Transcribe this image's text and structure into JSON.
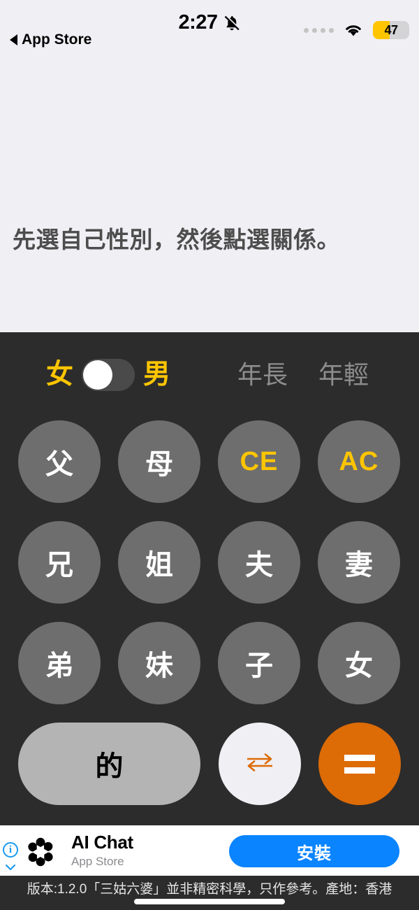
{
  "status_bar": {
    "time": "2:27",
    "back_label": "App Store",
    "bell_icon": "bell-slash-icon",
    "wifi_icon": "wifi-icon",
    "battery_percent": "47",
    "battery_level": 47,
    "battery_color": "#FFC500",
    "signal_dots": 4
  },
  "content": {
    "instruction": "先選自己性別，然後點選關係。",
    "background_color": "#f0eff4",
    "text_color": "#4d4d4d"
  },
  "controls": {
    "gender": {
      "left_label": "女",
      "right_label": "男",
      "selected": "女",
      "knob_position": "left",
      "accent_color": "#FFC500",
      "track_color": "#4a4a4a"
    },
    "age": {
      "elder_label": "年長",
      "younger_label": "年輕",
      "color": "#8d8d8d"
    }
  },
  "keypad": {
    "key_color": "#6e6e6e",
    "accent_color": "#FFC500",
    "keys": [
      {
        "label": "父",
        "name": "key-father",
        "accent": false
      },
      {
        "label": "母",
        "name": "key-mother",
        "accent": false
      },
      {
        "label": "CE",
        "name": "key-clear-entry",
        "accent": true
      },
      {
        "label": "AC",
        "name": "key-all-clear",
        "accent": true
      },
      {
        "label": "兄",
        "name": "key-elder-brother",
        "accent": false
      },
      {
        "label": "姐",
        "name": "key-elder-sister",
        "accent": false
      },
      {
        "label": "夫",
        "name": "key-husband",
        "accent": false
      },
      {
        "label": "妻",
        "name": "key-wife",
        "accent": false
      },
      {
        "label": "弟",
        "name": "key-younger-brother",
        "accent": false
      },
      {
        "label": "妹",
        "name": "key-younger-sister",
        "accent": false
      },
      {
        "label": "子",
        "name": "key-son",
        "accent": false
      },
      {
        "label": "女",
        "name": "key-daughter",
        "accent": false
      }
    ]
  },
  "actions": {
    "possessive_label": "的",
    "possessive_color": "#b4b4b4",
    "swap_icon": "swap-arrows-icon",
    "swap_icon_color": "#DD6B06",
    "equals_label": "=",
    "equals_color": "#DD6B06"
  },
  "ad": {
    "info_icon": "info-icon",
    "chevron_icon": "chevron-down-icon",
    "app_icon": "openai-flower-icon",
    "title": "AI Chat",
    "subtitle": "App Store",
    "cta_label": "安裝",
    "cta_color": "#0a84ff"
  },
  "footer": {
    "text": "版本:1.2.0「三姑六婆」並非精密科學，只作參考。產地：香港"
  }
}
